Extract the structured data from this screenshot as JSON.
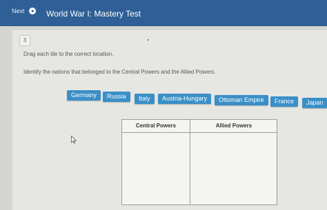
{
  "header": {
    "next_label": "Next",
    "title": "World War I: Mastery Test"
  },
  "question": {
    "number": "3",
    "instruction": "Drag each tile to the correct location.",
    "prompt": "Identify the nations that belonged to the Central Powers and the Allied Powers."
  },
  "tiles": [
    {
      "label": "Germany"
    },
    {
      "label": "Russia"
    },
    {
      "label": "Italy"
    },
    {
      "label": "Austria-Hungary"
    },
    {
      "label": "Ottoman Empire"
    },
    {
      "label": "France"
    },
    {
      "label": "Japan"
    }
  ],
  "table": {
    "headers": [
      "Central Powers",
      "Allied Powers"
    ]
  },
  "icons": {
    "next": "next-arrow-icon",
    "cursor": "mouse-cursor-icon"
  },
  "colors": {
    "topbar": "#2e5f96",
    "tile": "#3a8fc7"
  }
}
